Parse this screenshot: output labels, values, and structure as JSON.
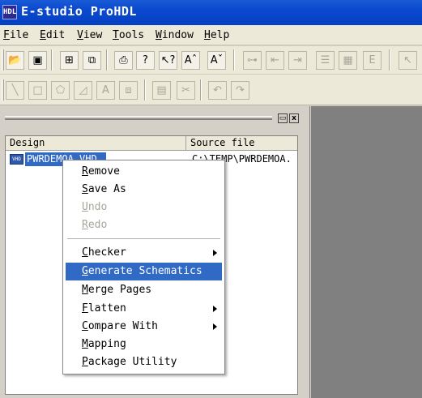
{
  "window": {
    "title": "E-studio ProHDL",
    "icon": "app-icon",
    "icon_text": "HDL"
  },
  "menubar": [
    {
      "label": "File",
      "u": "F",
      "rest": "ile"
    },
    {
      "label": "Edit",
      "u": "E",
      "rest": "dit"
    },
    {
      "label": "View",
      "u": "V",
      "rest": "iew"
    },
    {
      "label": "Tools",
      "u": "T",
      "rest": "ools"
    },
    {
      "label": "Window",
      "u": "W",
      "rest": "indow"
    },
    {
      "label": "Help",
      "u": "H",
      "rest": "elp"
    }
  ],
  "toolbar1": {
    "buttons": [
      {
        "name": "open-icon",
        "glyph": "📂"
      },
      {
        "name": "save-icon",
        "glyph": "▣"
      },
      {
        "name": "design-view-icon",
        "glyph": "⊞"
      },
      {
        "name": "schematic-icon",
        "glyph": "⧉"
      },
      {
        "name": "print-icon",
        "glyph": "⎙"
      },
      {
        "name": "help-icon",
        "glyph": "?"
      },
      {
        "name": "context-help-icon",
        "glyph": "↖?"
      },
      {
        "name": "font-increase-icon",
        "glyph": "Aˆ"
      },
      {
        "name": "font-decrease-icon",
        "glyph": "Aˇ"
      },
      {
        "name": "hierarchy-icon",
        "glyph": "⊶"
      },
      {
        "name": "step-back-icon",
        "glyph": "⇤"
      },
      {
        "name": "step-forward-icon",
        "glyph": "⇥"
      },
      {
        "name": "list-icon",
        "glyph": "☰"
      },
      {
        "name": "grid-icon",
        "glyph": "▦"
      },
      {
        "name": "entity-icon",
        "glyph": "E"
      },
      {
        "name": "select-arrow-icon",
        "glyph": "↖"
      }
    ]
  },
  "toolbar2": {
    "buttons": [
      {
        "name": "line-tool-icon",
        "glyph": "╲"
      },
      {
        "name": "rectangle-tool-icon",
        "glyph": "□"
      },
      {
        "name": "polygon-tool-icon",
        "glyph": "⬠"
      },
      {
        "name": "shape-tool-icon",
        "glyph": "◿"
      },
      {
        "name": "text-tool-icon",
        "glyph": "A"
      },
      {
        "name": "symbol-tool-icon",
        "glyph": "⧈"
      },
      {
        "name": "bus-tool-icon",
        "glyph": "▤"
      },
      {
        "name": "cut-tool-icon",
        "glyph": "✂"
      },
      {
        "name": "undo-tool-icon",
        "glyph": "↶"
      },
      {
        "name": "redo-tool-icon",
        "glyph": "↷"
      }
    ]
  },
  "panel": {
    "buttons": {
      "restore": "▭",
      "close": "x"
    },
    "columns": {
      "design": "Design",
      "source": "Source file"
    },
    "row": {
      "design": "PWRDEMOA.VHD",
      "source": "C:\\TEMP\\PWRDEMOA."
    }
  },
  "context_menu": {
    "items": [
      {
        "u": "R",
        "rest": "emove",
        "label": "Remove"
      },
      {
        "u": "S",
        "rest": "ave As",
        "label": "Save As"
      },
      {
        "u": "U",
        "rest": "ndo",
        "label": "Undo"
      },
      {
        "u": "R",
        "rest": "edo",
        "label": "Redo"
      },
      {
        "u": "C",
        "rest": "hecker",
        "label": "Checker"
      },
      {
        "u": "G",
        "rest": "enerate Schematics",
        "label": "Generate Schematics"
      },
      {
        "u": "M",
        "rest": "erge Pages",
        "label": "Merge Pages"
      },
      {
        "u": "F",
        "rest": "latten",
        "label": "Flatten"
      },
      {
        "u": "C",
        "rest": "ompare With",
        "label": "Compare With"
      },
      {
        "u": "M",
        "rest": "apping",
        "label": "Mapping"
      },
      {
        "u": "P",
        "rest": "ackage Utility",
        "label": "Package Utility"
      }
    ]
  }
}
